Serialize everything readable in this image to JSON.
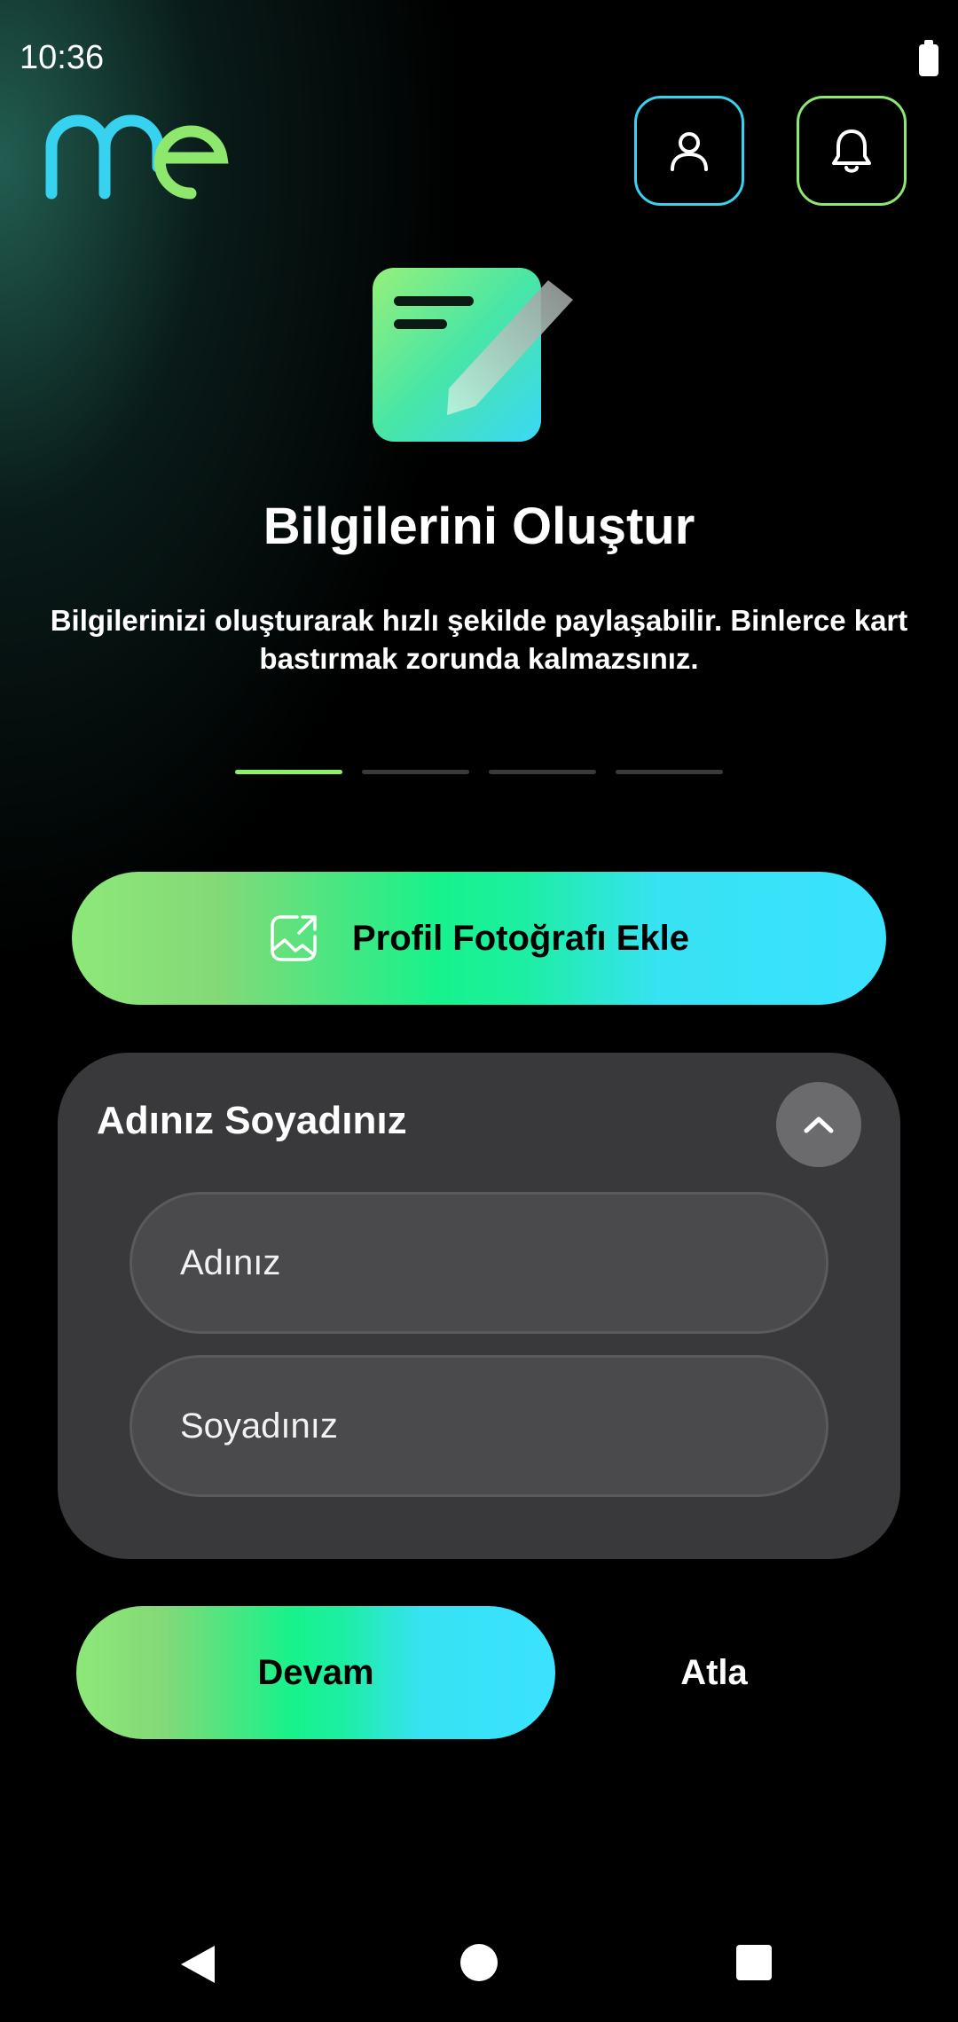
{
  "status_bar": {
    "time": "10:36"
  },
  "header": {
    "logo_text": "me"
  },
  "hero": {
    "title": "Bilgilerini Oluştur",
    "subtitle": "Bilgilerinizi oluşturarak hızlı şekilde paylaşabilir. Binlerce kart bastırmak zorunda kalmazsınız."
  },
  "progress": {
    "total_steps": 4,
    "current_step": 1
  },
  "photo_button": {
    "label": "Profil Fotoğrafı Ekle"
  },
  "name_card": {
    "title": "Adınız Soyadınız",
    "first_name": {
      "placeholder": "Adınız",
      "value": ""
    },
    "last_name": {
      "placeholder": "Soyadınız",
      "value": ""
    }
  },
  "actions": {
    "continue_label": "Devam",
    "skip_label": "Atla"
  },
  "colors": {
    "accent_green": "#8df26b",
    "accent_cyan": "#36d2ef",
    "card_bg": "#39393b",
    "field_bg": "#4a4a4c"
  },
  "icons": {
    "profile": "user-icon",
    "notifications": "bell-icon",
    "photo": "image-upload-icon",
    "collapse": "chevron-up-icon",
    "hero": "edit-note-icon"
  }
}
